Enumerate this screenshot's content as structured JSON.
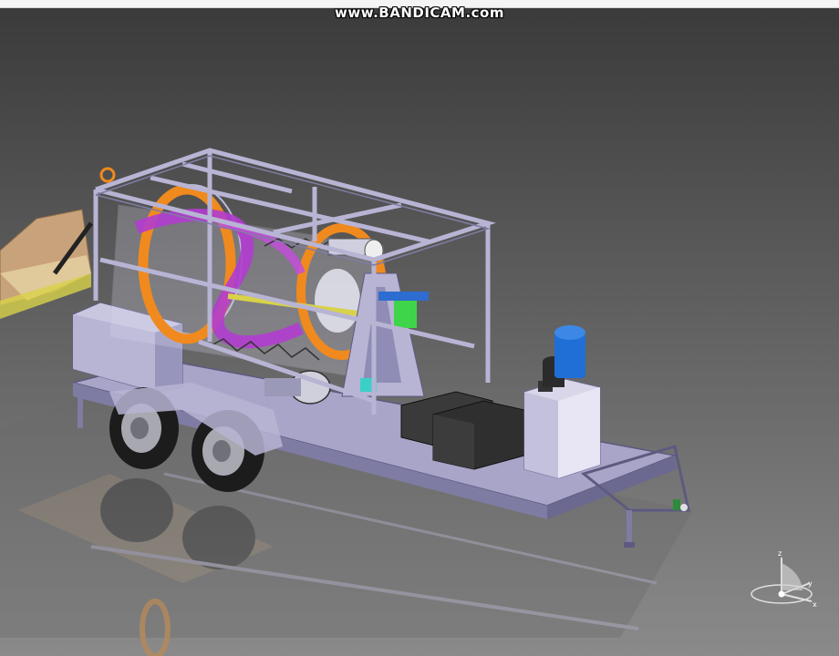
{
  "watermark": {
    "text": "www.BANDICAM.com"
  },
  "axis_triad": {
    "z_label": "z",
    "y_label": "y",
    "x_label": "x"
  },
  "colors": {
    "frame": "#b7b4d4",
    "frame_dark": "#7f7ca3",
    "ring": "#f08a1e",
    "helix": "#b13ccf",
    "hopper": "#c8a27a",
    "motor": "#1f6fd6",
    "tank": "#d9d6ea",
    "tire": "#1c1c1c"
  }
}
